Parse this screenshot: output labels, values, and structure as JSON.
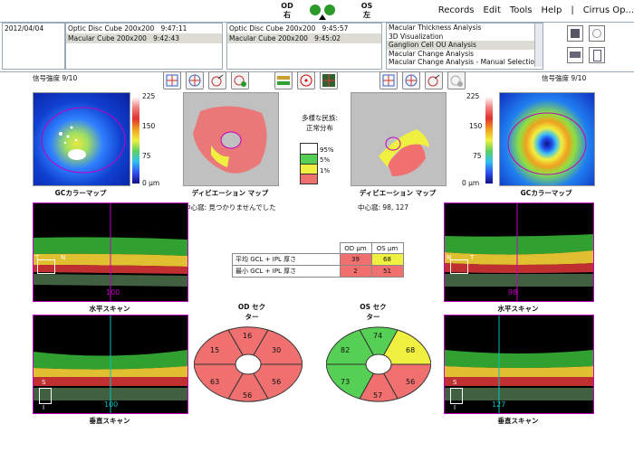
{
  "menu": [
    "Records",
    "Edit",
    "Tools",
    "Help",
    "|",
    "Cirrus Op..."
  ],
  "eyes": {
    "od": "OD",
    "od_sub": "右",
    "os": "OS",
    "os_sub": "左"
  },
  "exam_date": "2012/04/04",
  "od_scans": [
    {
      "name": "Optic Disc Cube 200x200",
      "time": "9:47:11"
    },
    {
      "name": "Macular Cube 200x200",
      "time": "9:42:43"
    }
  ],
  "os_scans": [
    {
      "name": "Optic Disc Cube 200x200",
      "time": "9:45:57"
    },
    {
      "name": "Macular Cube 200x200",
      "time": "9:45:02"
    }
  ],
  "analyses": [
    "Macular Thickness Analysis",
    "3D Visualization",
    "Ganglion Cell OU Analysis",
    "Macular Change Analysis",
    "Macular Change Analysis - Manual Selection"
  ],
  "signal_strength_od": "信号強度  9/10",
  "signal_strength_os": "信号強度  9/10",
  "colorscale": {
    "max": "225",
    "mid1": "150",
    "mid2": "75",
    "min": "0 µm"
  },
  "gc_map_label": "GCカラーマップ",
  "deviation_map_label": "ディビエーション マップ",
  "fovea_od": "中心窩: 見つかりませんでした",
  "fovea_os": "中心窩: 98, 127",
  "legend": {
    "title": "多様な民族:\n正常分布",
    "items": [
      "95%",
      "5%",
      "1%"
    ]
  },
  "table": {
    "headers": [
      "",
      "OD µm",
      "OS µm"
    ],
    "rows": [
      {
        "label": "平均 GCL + IPL 厚さ",
        "od": "39",
        "os": "68"
      },
      {
        "label": "最小 GCL + IPL 厚さ",
        "od": "2",
        "os": "51"
      }
    ]
  },
  "horizontal_scan_label": "水平スキャン",
  "vertical_scan_label": "垂直スキャン",
  "od_h_slice": "100",
  "od_v_slice": "100",
  "os_h_slice": "98",
  "os_v_slice": "127",
  "od_sector_title": "OD セク\nター",
  "os_sector_title": "OS セク\nター",
  "od_sectors": {
    "top": "16",
    "top_right": "30",
    "bottom_right": "56",
    "bottom": "56",
    "bottom_left": "63",
    "top_left": "15"
  },
  "os_sectors": {
    "top": "74",
    "top_right": "68",
    "bottom_right": "56",
    "bottom": "57",
    "bottom_left": "73",
    "top_left": "82"
  },
  "colors": {
    "red": "#f07070",
    "yellow": "#f0f040",
    "green": "#55d055",
    "cyan": "#00c0c0",
    "magenta": "#c000c0"
  },
  "orient": {
    "T": "T",
    "N": "N",
    "S": "S",
    "I": "I"
  }
}
